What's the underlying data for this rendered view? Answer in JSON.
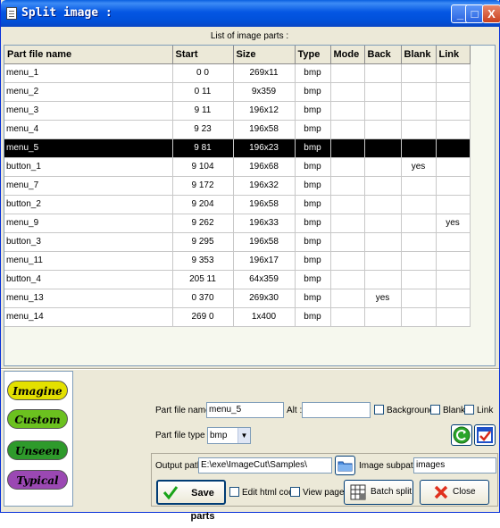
{
  "window": {
    "title": "Split image :",
    "min_glyph": "_",
    "max_glyph": "□",
    "close_glyph": "X"
  },
  "list": {
    "caption": "List of image parts :",
    "columns": [
      "Part file name",
      "Start",
      "Size",
      "Type",
      "Mode",
      "Back",
      "Blank",
      "Link"
    ],
    "rows": [
      {
        "name": "menu_1",
        "start": "0 0",
        "size": "269x11",
        "type": "bmp",
        "mode": "",
        "back": "",
        "blank": "",
        "link": ""
      },
      {
        "name": "menu_2",
        "start": "0 11",
        "size": "9x359",
        "type": "bmp",
        "mode": "",
        "back": "",
        "blank": "",
        "link": ""
      },
      {
        "name": "menu_3",
        "start": "9 11",
        "size": "196x12",
        "type": "bmp",
        "mode": "",
        "back": "",
        "blank": "",
        "link": ""
      },
      {
        "name": "menu_4",
        "start": "9 23",
        "size": "196x58",
        "type": "bmp",
        "mode": "",
        "back": "",
        "blank": "",
        "link": ""
      },
      {
        "name": "menu_5",
        "start": "9 81",
        "size": "196x23",
        "type": "bmp",
        "mode": "",
        "back": "",
        "blank": "",
        "link": "",
        "selected": true
      },
      {
        "name": "button_1",
        "start": "9 104",
        "size": "196x68",
        "type": "bmp",
        "mode": "",
        "back": "",
        "blank": "yes",
        "link": ""
      },
      {
        "name": "menu_7",
        "start": "9 172",
        "size": "196x32",
        "type": "bmp",
        "mode": "",
        "back": "",
        "blank": "",
        "link": ""
      },
      {
        "name": "button_2",
        "start": "9 204",
        "size": "196x58",
        "type": "bmp",
        "mode": "",
        "back": "",
        "blank": "",
        "link": ""
      },
      {
        "name": "menu_9",
        "start": "9 262",
        "size": "196x33",
        "type": "bmp",
        "mode": "",
        "back": "",
        "blank": "",
        "link": "yes"
      },
      {
        "name": "button_3",
        "start": "9 295",
        "size": "196x58",
        "type": "bmp",
        "mode": "",
        "back": "",
        "blank": "",
        "link": ""
      },
      {
        "name": "menu_11",
        "start": "9 353",
        "size": "196x17",
        "type": "bmp",
        "mode": "",
        "back": "",
        "blank": "",
        "link": ""
      },
      {
        "name": "button_4",
        "start": "205 11",
        "size": "64x359",
        "type": "bmp",
        "mode": "",
        "back": "",
        "blank": "",
        "link": ""
      },
      {
        "name": "menu_13",
        "start": "0 370",
        "size": "269x30",
        "type": "bmp",
        "mode": "",
        "back": "yes",
        "blank": "",
        "link": ""
      },
      {
        "name": "menu_14",
        "start": "269 0",
        "size": "1x400",
        "type": "bmp",
        "mode": "",
        "back": "",
        "blank": "",
        "link": ""
      }
    ]
  },
  "thumbnails": [
    {
      "label": "Imagine",
      "color": "#e3e000"
    },
    {
      "label": "Custom",
      "color": "#6bc11f"
    },
    {
      "label": "Unseen",
      "color": "#2e9a2b"
    },
    {
      "label": "Typical",
      "color": "#9b48b3"
    }
  ],
  "form": {
    "part_name_label": "Part file name :",
    "part_name_value": "menu_5",
    "alt_label": "Alt :",
    "alt_value": "",
    "background_label": "Background",
    "blank_label": "Blank",
    "link_label": "Link",
    "part_type_label": "Part file type :",
    "part_type_value": "bmp",
    "output_label": "Output path :",
    "output_value": "E:\\exe\\ImageCut\\Samples\\",
    "subpath_label": "Image subpath :",
    "subpath_value": "images",
    "save_label": "Save parts",
    "edit_html_label": "Edit html code",
    "view_page_label": "View page",
    "batch_label": "Batch split",
    "close_label": "Close"
  },
  "icons": {
    "browse": "folder-icon",
    "refresh": "refresh-icon",
    "check": "checklist-icon",
    "save": "green-check-icon",
    "batch": "grid-icon",
    "close": "red-x-icon"
  },
  "colors": {
    "titlebar": "#0456e3",
    "selected_row": "#000000",
    "refresh": "#2aa52a",
    "close_x": "#e0301e"
  }
}
